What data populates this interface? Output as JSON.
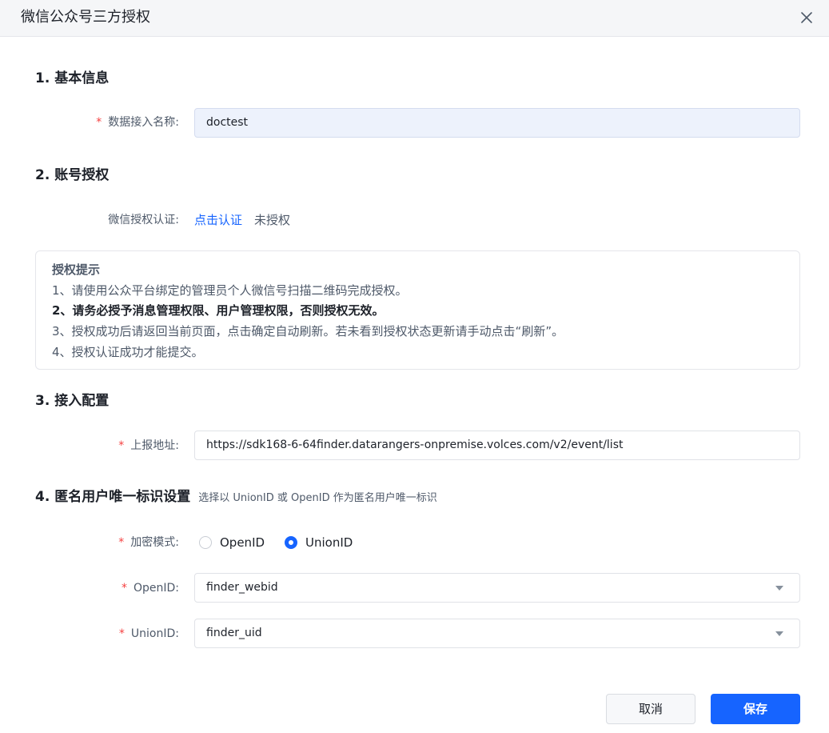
{
  "dialog": {
    "title": "微信公众号三方授权",
    "close_icon": "close-icon"
  },
  "basic_info": {
    "section_title": "1. 基本信息",
    "name_label": "数据接入名称:",
    "name_value": "doctest"
  },
  "account_auth": {
    "section_title": "2. 账号授权",
    "auth_label": "微信授权认证:",
    "auth_link": "点击认证",
    "auth_status": "未授权",
    "tips": {
      "title": "授权提示",
      "lines": [
        "1、请使用公众平台绑定的管理员个人微信号扫描二维码完成授权。",
        "2、请务必授予消息管理权限、用户管理权限，否则授权无效。",
        "3、授权成功后请返回当前页面，点击确定自动刷新。若未看到授权状态更新请手动点击“刷新”。",
        "4、授权认证成功才能提交。"
      ]
    }
  },
  "access_config": {
    "section_title": "3. 接入配置",
    "report_url_label": "上报地址:",
    "report_url_value": "https://sdk168-6-64finder.datarangers-onpremise.volces.com/v2/event/list"
  },
  "anon_id": {
    "section_title": "4. 匿名用户唯一标识设置",
    "section_hint": "选择以 UnionID 或 OpenID 作为匿名用户唯一标识",
    "encrypt_label": "加密模式:",
    "options": [
      {
        "label": "OpenID",
        "checked": false
      },
      {
        "label": "UnionID",
        "checked": true
      }
    ],
    "openid_label": "OpenID:",
    "openid_value": "finder_webid",
    "unionid_label": "UnionID:",
    "unionid_value": "finder_uid"
  },
  "footer": {
    "cancel_label": "取消",
    "save_label": "保存"
  },
  "colors": {
    "primary": "#1664ff",
    "required": "#f53f3f",
    "header_bg": "#f5f6f8"
  }
}
